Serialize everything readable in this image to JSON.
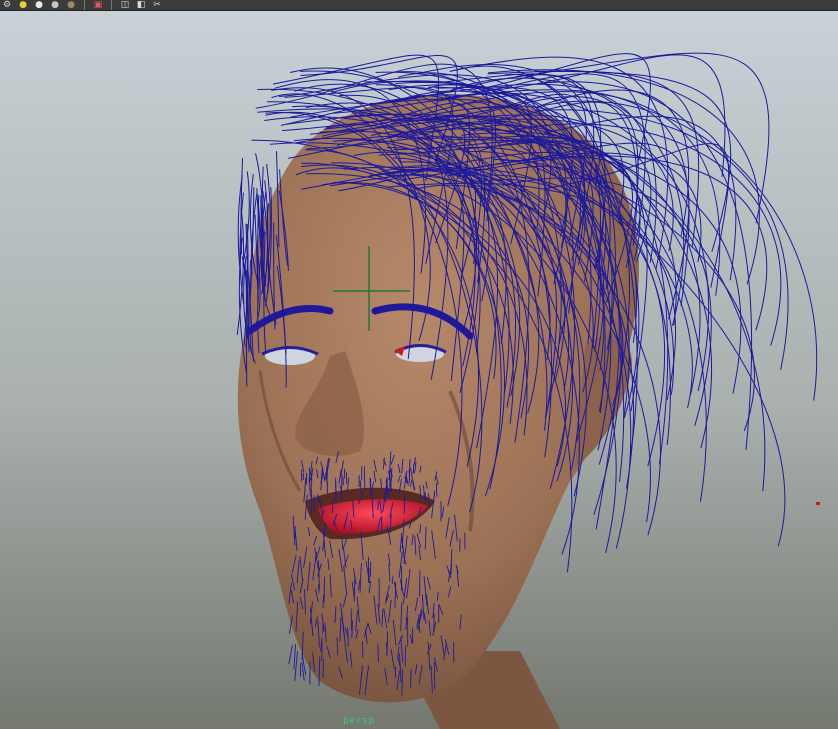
{
  "toolbar": {
    "icons": [
      {
        "name": "shading-gear-icon",
        "glyph": "⚙",
        "color": "#d8d8d8"
      },
      {
        "name": "default-light-icon",
        "glyph": "●",
        "color": "#e4d23a"
      },
      {
        "name": "all-lights-icon",
        "glyph": "●",
        "color": "#e9e9e9"
      },
      {
        "name": "shadows-icon",
        "glyph": "●",
        "color": "#c6c6c6"
      },
      {
        "name": "ambient-occlusion-icon",
        "glyph": "●",
        "color": "#9d8a62"
      },
      {
        "name": "isolate-select-icon",
        "glyph": "▣",
        "color": "#e25a5a"
      },
      {
        "name": "xray-icon",
        "glyph": "◫",
        "color": "#dcdcdc"
      },
      {
        "name": "xray-joints-icon",
        "glyph": "◧",
        "color": "#dcdcdc"
      },
      {
        "name": "xray-active-icon",
        "glyph": "✂",
        "color": "#dcdcdc"
      }
    ]
  },
  "viewport": {
    "camera": "persp",
    "colors": {
      "skin": "#a3795d",
      "skin_shadow": "#6e4a35",
      "hair": "#1d1a9a",
      "teeth": "#d3142c",
      "eye": "#cfd4df",
      "manipulator": "#1e7a3a",
      "background_top": "#c9d2d7",
      "background_bottom": "#7b7f78"
    }
  }
}
